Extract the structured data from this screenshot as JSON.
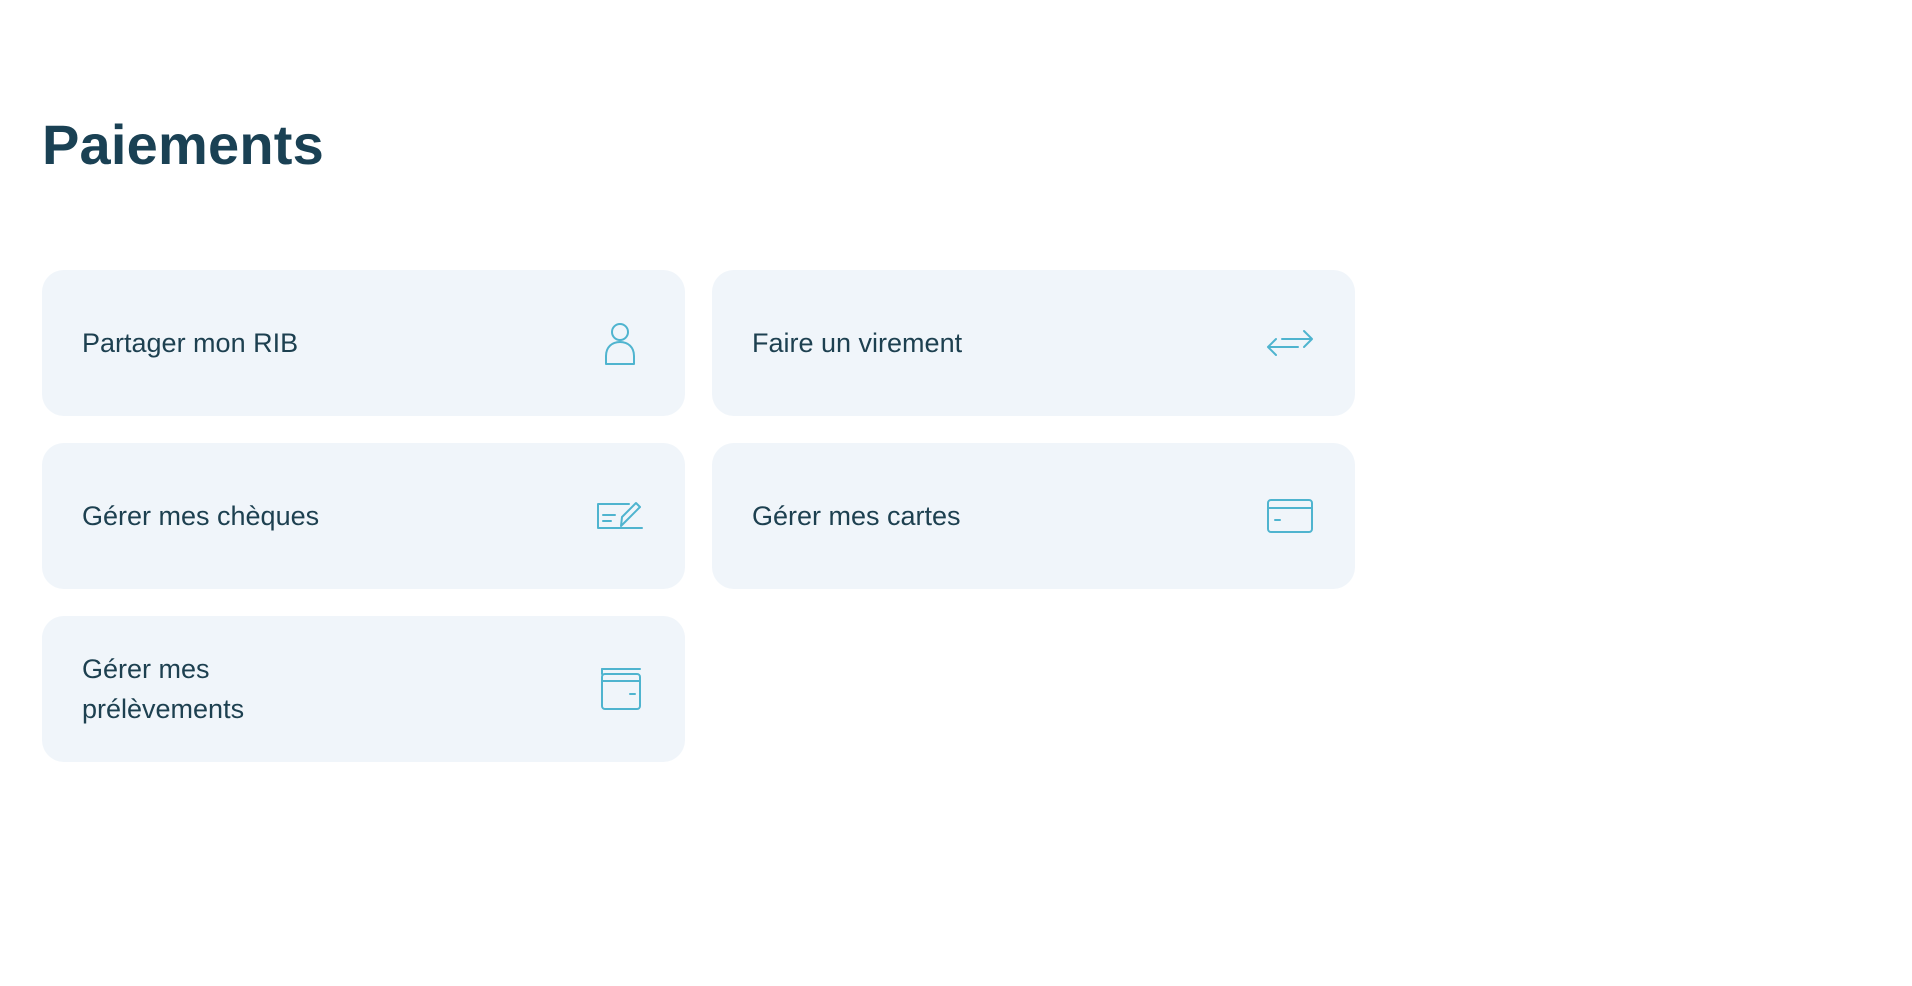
{
  "page": {
    "title": "Paiements"
  },
  "actions": [
    {
      "label": "Partager mon RIB",
      "icon": "user-icon"
    },
    {
      "label": "Faire un virement",
      "icon": "transfer-arrows-icon"
    },
    {
      "label": "Gérer mes chèques",
      "icon": "cheque-icon"
    },
    {
      "label": "Gérer mes cartes",
      "icon": "credit-card-icon"
    },
    {
      "label": "Gérer mes prélèvements",
      "icon": "wallet-icon"
    }
  ],
  "colors": {
    "title": "#1a4154",
    "text": "#1d4050",
    "tile_background": "#f0f5fa",
    "icon_accent": "#4fb4cf"
  }
}
